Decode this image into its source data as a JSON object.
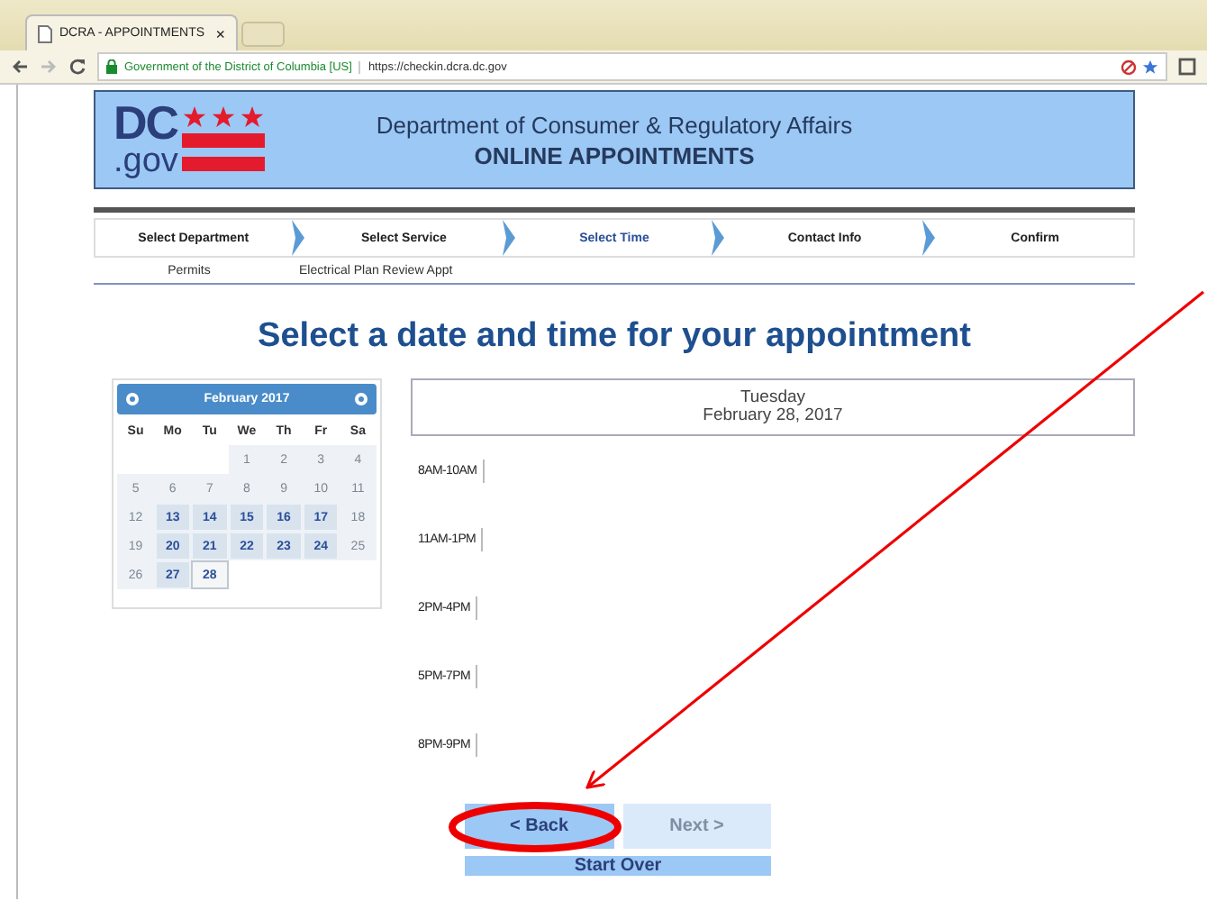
{
  "browser": {
    "tab_title": "DCRA - APPOINTMENTS",
    "tab_close": "×",
    "site_identity": "Government of the District of Columbia [US]",
    "url": "https://checkin.dcra.dc.gov"
  },
  "header": {
    "logo_main": "DC",
    "logo_sub": ".gov",
    "agency": "Department of Consumer & Regulatory Affairs",
    "title": "ONLINE APPOINTMENTS"
  },
  "steps": [
    {
      "label": "Select Department",
      "selected": false,
      "choice": "Permits"
    },
    {
      "label": "Select Service",
      "selected": false,
      "choice": "Electrical Plan Review Appt"
    },
    {
      "label": "Select Time",
      "selected": true
    },
    {
      "label": "Contact Info",
      "selected": false
    },
    {
      "label": "Confirm",
      "selected": false
    }
  ],
  "heading": "Select a date and time for your appointment",
  "calendar": {
    "month": "February 2017",
    "weekdays": [
      "Su",
      "Mo",
      "Tu",
      "We",
      "Th",
      "Fr",
      "Sa"
    ],
    "weeks": [
      [
        {
          "kind": "empty"
        },
        {
          "kind": "empty"
        },
        {
          "kind": "empty"
        },
        {
          "day": "1",
          "available": false,
          "selected": false
        },
        {
          "day": "2",
          "available": false,
          "selected": false
        },
        {
          "day": "3",
          "available": false,
          "selected": false
        },
        {
          "day": "4",
          "available": false,
          "selected": false
        }
      ],
      [
        {
          "day": "5",
          "available": false,
          "selected": false
        },
        {
          "day": "6",
          "available": false,
          "selected": false
        },
        {
          "day": "7",
          "available": false,
          "selected": false
        },
        {
          "day": "8",
          "available": false,
          "selected": false
        },
        {
          "day": "9",
          "available": false,
          "selected": false
        },
        {
          "day": "10",
          "available": false,
          "selected": false
        },
        {
          "day": "11",
          "available": false,
          "selected": false
        }
      ],
      [
        {
          "day": "12",
          "available": false,
          "selected": false
        },
        {
          "day": "13",
          "available": true,
          "selected": false
        },
        {
          "day": "14",
          "available": true,
          "selected": false
        },
        {
          "day": "15",
          "available": true,
          "selected": false
        },
        {
          "day": "16",
          "available": true,
          "selected": false
        },
        {
          "day": "17",
          "available": true,
          "selected": false
        },
        {
          "day": "18",
          "available": false,
          "selected": false
        }
      ],
      [
        {
          "day": "19",
          "available": false,
          "selected": false
        },
        {
          "day": "20",
          "available": true,
          "selected": false
        },
        {
          "day": "21",
          "available": true,
          "selected": false
        },
        {
          "day": "22",
          "available": true,
          "selected": false
        },
        {
          "day": "23",
          "available": true,
          "selected": false
        },
        {
          "day": "24",
          "available": true,
          "selected": false
        },
        {
          "day": "25",
          "available": false,
          "selected": false
        }
      ],
      [
        {
          "day": "26",
          "available": false,
          "selected": false
        },
        {
          "day": "27",
          "available": true,
          "selected": false
        },
        {
          "day": "28",
          "available": true,
          "selected": true
        }
      ]
    ]
  },
  "day_panel": {
    "weekday": "Tuesday",
    "date": "February 28, 2017"
  },
  "time_slots": [
    "8AM-10AM",
    "11AM-1PM",
    "2PM-4PM",
    "5PM-7PM",
    "8PM-9PM"
  ],
  "buttons": [
    {
      "label": "< Back",
      "disabled": false
    },
    {
      "label": "Next >",
      "disabled": true
    }
  ],
  "start_over": "Start Over"
}
